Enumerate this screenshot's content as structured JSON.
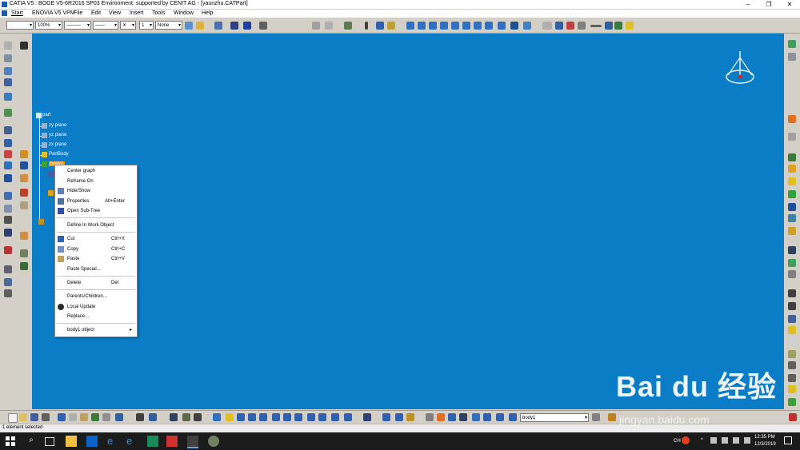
{
  "window": {
    "title": "CATIA V5 : BOGE V5-6R2016 SP03 Environment: supported by CENIT AG - [yaunzhu.CATPart]",
    "controls": [
      "–",
      "❐",
      "✕"
    ]
  },
  "menubar": {
    "items": [
      "Start",
      "ENOVIA V5 VPM",
      "File",
      "Edit",
      "View",
      "Insert",
      "Tools",
      "Window",
      "Help"
    ]
  },
  "toolbar_top": {
    "zoom_value": "100%",
    "layer_value": "None"
  },
  "tree": {
    "root": "part",
    "planes": [
      "zy plane",
      "yz plane",
      "zx plane"
    ],
    "body": "PartBody",
    "selected": "body1"
  },
  "context_menu": {
    "items": [
      {
        "label": "Center graph",
        "shortcut": ""
      },
      {
        "label": "Reframe On",
        "shortcut": ""
      },
      {
        "label": "Hide/Show",
        "shortcut": ""
      },
      {
        "label": "Properties",
        "shortcut": "Alt+Enter"
      },
      {
        "label": "Open Sub-Tree",
        "shortcut": ""
      },
      {
        "label": "Define In Work Object",
        "shortcut": ""
      },
      {
        "label": "Cut",
        "shortcut": "Ctrl+X"
      },
      {
        "label": "Copy",
        "shortcut": "Ctrl+C"
      },
      {
        "label": "Paste",
        "shortcut": "Ctrl+V"
      },
      {
        "label": "Paste Special...",
        "shortcut": ""
      },
      {
        "label": "Delete",
        "shortcut": "Del"
      },
      {
        "label": "Parents/Children...",
        "shortcut": ""
      },
      {
        "label": "Local Update",
        "shortcut": ""
      },
      {
        "label": "Replace...",
        "shortcut": ""
      },
      {
        "label": "body1 object",
        "shortcut": "▸"
      }
    ]
  },
  "toolbar_bottom": {
    "body_combo": "body1"
  },
  "status": {
    "text": "1 element selected"
  },
  "taskbar": {
    "lang": "CH",
    "time": "12:35 PM",
    "date": "12/3/2019"
  },
  "watermark": {
    "text": "Bai du 经验",
    "url": "jingyan.baidu.com"
  },
  "colors": {
    "viewport": "#0b7cc6",
    "highlight": "#e8102a",
    "selected": "#f39a1e"
  }
}
